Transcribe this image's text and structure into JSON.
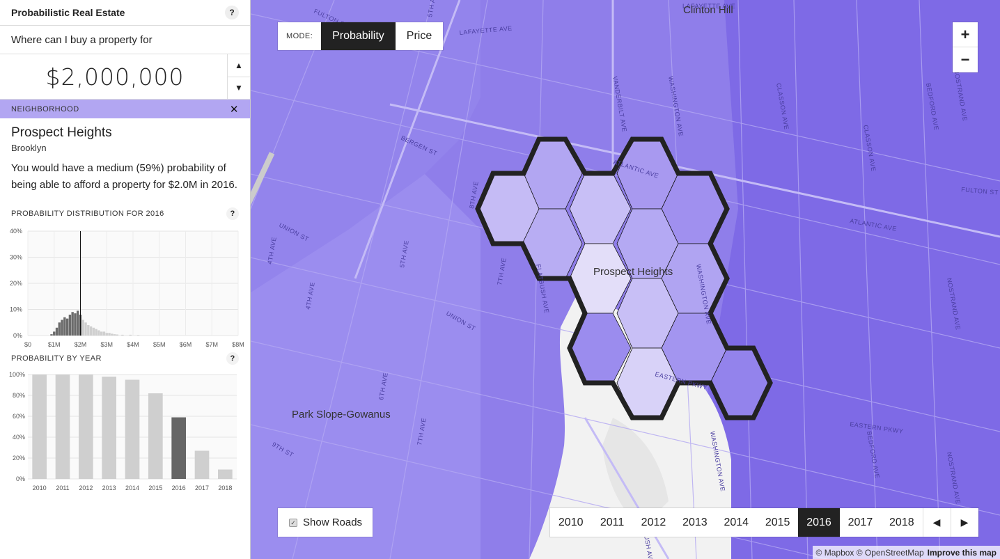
{
  "app": {
    "title": "Probabilistic Real Estate"
  },
  "query": {
    "prompt": "Where can I buy a property for",
    "price": "$2,000,000"
  },
  "neighborhood": {
    "section_label": "NEIGHBORHOOD",
    "name": "Prospect Heights",
    "borough": "Brooklyn",
    "description": "You would have a medium (59%) probability of being able to afford a property for $2.0M in 2016."
  },
  "distribution": {
    "section_label": "PROBABILITY DISTRIBUTION FOR 2016"
  },
  "by_year": {
    "section_label": "PROBABILITY BY YEAR"
  },
  "chart_data": [
    {
      "type": "bar",
      "title": "PROBABILITY DISTRIBUTION FOR 2016",
      "xlabel": "",
      "ylabel": "",
      "x_ticks": [
        "$0",
        "$1M",
        "$2M",
        "$3M",
        "$4M",
        "$5M",
        "$6M",
        "$7M",
        "$8M"
      ],
      "y_ticks": [
        "0%",
        "10%",
        "20%",
        "30%",
        "40%"
      ],
      "xlim": [
        0,
        8
      ],
      "ylim": [
        0,
        40
      ],
      "marker_x": 2.0,
      "x": [
        0.9,
        1.0,
        1.1,
        1.2,
        1.3,
        1.4,
        1.5,
        1.6,
        1.7,
        1.8,
        1.9,
        2.0,
        2.1,
        2.2,
        2.3,
        2.4,
        2.5,
        2.6,
        2.7,
        2.8,
        2.9,
        3.0,
        3.1,
        3.2,
        3.3,
        3.4,
        3.6,
        3.9,
        4.2
      ],
      "values": [
        0.5,
        1.5,
        3,
        5,
        6,
        7,
        6.5,
        8,
        9,
        8.5,
        9.5,
        8,
        6,
        5,
        4,
        3.5,
        3,
        2.5,
        2,
        1.5,
        1.5,
        1,
        1,
        0.7,
        0.5,
        0.4,
        0.3,
        0.3,
        0.2
      ],
      "grid": true
    },
    {
      "type": "bar",
      "title": "PROBABILITY BY YEAR",
      "xlabel": "",
      "ylabel": "",
      "categories": [
        "2010",
        "2011",
        "2012",
        "2013",
        "2014",
        "2015",
        "2016",
        "2017",
        "2018"
      ],
      "values": [
        100,
        100,
        100,
        98,
        95,
        82,
        59,
        27,
        9
      ],
      "y_ticks": [
        "0%",
        "20%",
        "40%",
        "60%",
        "80%",
        "100%"
      ],
      "ylim": [
        0,
        100
      ],
      "highlight": "2016",
      "grid": true
    }
  ],
  "map": {
    "mode_label": "MODE:",
    "modes": [
      "Probability",
      "Price"
    ],
    "active_mode": "Probability",
    "zoom_in": "+",
    "zoom_out": "−",
    "show_roads_label": "Show Roads",
    "show_roads_checked": true,
    "years": [
      "2010",
      "2011",
      "2012",
      "2013",
      "2014",
      "2015",
      "2016",
      "2017",
      "2018"
    ],
    "active_year": "2016",
    "prev_label": "◀",
    "next_label": "▶",
    "attribution": "© Mapbox © OpenStreetMap",
    "improve": "Improve this map",
    "place_labels": {
      "clinton_hill": "Clinton Hill",
      "prospect_heights": "Prospect Heights",
      "park_slope": "Park Slope-Gowanus"
    },
    "street_labels": [
      "ATLANTIC AVE",
      "ATLANTIC AVE",
      "FULTON ST",
      "FULTON ST",
      "LAFAYETTE AVE",
      "LAFAYETTE AVE",
      "UNION ST",
      "UNION ST",
      "BERGEN ST",
      "EASTERN PKWY",
      "EASTERN PKWY",
      "WASHINGTON AVE",
      "WASHINGTON AVE",
      "WASHINGTON AVE",
      "VANDERBILT AVE",
      "CLASSON AVE",
      "CLASSON AVE",
      "BEDFORD AVE",
      "BEDFORD AVE",
      "NOSTRAND AVE",
      "NOSTRAND AVE",
      "NOSTRAND AVE",
      "FLATBUSH AVE",
      "FLATBUSH AVE",
      "4TH AVE",
      "5TH AVE",
      "6TH AVE",
      "7TH AVE",
      "7TH AVE",
      "8TH AVE",
      "9TH ST",
      "5TH AVE",
      "4TH AVE"
    ],
    "colors": {
      "base": "#8f7eea",
      "highlight": "#c9c0f5",
      "outline": "#222222",
      "park": "#f2f2f2"
    }
  }
}
